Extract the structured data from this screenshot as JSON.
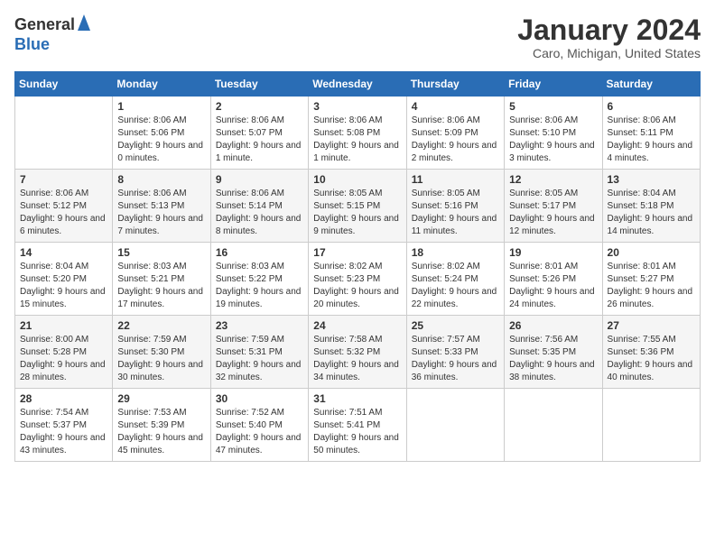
{
  "logo": {
    "general": "General",
    "blue": "Blue"
  },
  "title": {
    "month_year": "January 2024",
    "location": "Caro, Michigan, United States"
  },
  "days_of_week": [
    "Sunday",
    "Monday",
    "Tuesday",
    "Wednesday",
    "Thursday",
    "Friday",
    "Saturday"
  ],
  "weeks": [
    [
      {
        "day": "",
        "sunrise": "",
        "sunset": "",
        "daylight": ""
      },
      {
        "day": "1",
        "sunrise": "Sunrise: 8:06 AM",
        "sunset": "Sunset: 5:06 PM",
        "daylight": "Daylight: 9 hours and 0 minutes."
      },
      {
        "day": "2",
        "sunrise": "Sunrise: 8:06 AM",
        "sunset": "Sunset: 5:07 PM",
        "daylight": "Daylight: 9 hours and 1 minute."
      },
      {
        "day": "3",
        "sunrise": "Sunrise: 8:06 AM",
        "sunset": "Sunset: 5:08 PM",
        "daylight": "Daylight: 9 hours and 1 minute."
      },
      {
        "day": "4",
        "sunrise": "Sunrise: 8:06 AM",
        "sunset": "Sunset: 5:09 PM",
        "daylight": "Daylight: 9 hours and 2 minutes."
      },
      {
        "day": "5",
        "sunrise": "Sunrise: 8:06 AM",
        "sunset": "Sunset: 5:10 PM",
        "daylight": "Daylight: 9 hours and 3 minutes."
      },
      {
        "day": "6",
        "sunrise": "Sunrise: 8:06 AM",
        "sunset": "Sunset: 5:11 PM",
        "daylight": "Daylight: 9 hours and 4 minutes."
      }
    ],
    [
      {
        "day": "7",
        "sunrise": "Sunrise: 8:06 AM",
        "sunset": "Sunset: 5:12 PM",
        "daylight": "Daylight: 9 hours and 6 minutes."
      },
      {
        "day": "8",
        "sunrise": "Sunrise: 8:06 AM",
        "sunset": "Sunset: 5:13 PM",
        "daylight": "Daylight: 9 hours and 7 minutes."
      },
      {
        "day": "9",
        "sunrise": "Sunrise: 8:06 AM",
        "sunset": "Sunset: 5:14 PM",
        "daylight": "Daylight: 9 hours and 8 minutes."
      },
      {
        "day": "10",
        "sunrise": "Sunrise: 8:05 AM",
        "sunset": "Sunset: 5:15 PM",
        "daylight": "Daylight: 9 hours and 9 minutes."
      },
      {
        "day": "11",
        "sunrise": "Sunrise: 8:05 AM",
        "sunset": "Sunset: 5:16 PM",
        "daylight": "Daylight: 9 hours and 11 minutes."
      },
      {
        "day": "12",
        "sunrise": "Sunrise: 8:05 AM",
        "sunset": "Sunset: 5:17 PM",
        "daylight": "Daylight: 9 hours and 12 minutes."
      },
      {
        "day": "13",
        "sunrise": "Sunrise: 8:04 AM",
        "sunset": "Sunset: 5:18 PM",
        "daylight": "Daylight: 9 hours and 14 minutes."
      }
    ],
    [
      {
        "day": "14",
        "sunrise": "Sunrise: 8:04 AM",
        "sunset": "Sunset: 5:20 PM",
        "daylight": "Daylight: 9 hours and 15 minutes."
      },
      {
        "day": "15",
        "sunrise": "Sunrise: 8:03 AM",
        "sunset": "Sunset: 5:21 PM",
        "daylight": "Daylight: 9 hours and 17 minutes."
      },
      {
        "day": "16",
        "sunrise": "Sunrise: 8:03 AM",
        "sunset": "Sunset: 5:22 PM",
        "daylight": "Daylight: 9 hours and 19 minutes."
      },
      {
        "day": "17",
        "sunrise": "Sunrise: 8:02 AM",
        "sunset": "Sunset: 5:23 PM",
        "daylight": "Daylight: 9 hours and 20 minutes."
      },
      {
        "day": "18",
        "sunrise": "Sunrise: 8:02 AM",
        "sunset": "Sunset: 5:24 PM",
        "daylight": "Daylight: 9 hours and 22 minutes."
      },
      {
        "day": "19",
        "sunrise": "Sunrise: 8:01 AM",
        "sunset": "Sunset: 5:26 PM",
        "daylight": "Daylight: 9 hours and 24 minutes."
      },
      {
        "day": "20",
        "sunrise": "Sunrise: 8:01 AM",
        "sunset": "Sunset: 5:27 PM",
        "daylight": "Daylight: 9 hours and 26 minutes."
      }
    ],
    [
      {
        "day": "21",
        "sunrise": "Sunrise: 8:00 AM",
        "sunset": "Sunset: 5:28 PM",
        "daylight": "Daylight: 9 hours and 28 minutes."
      },
      {
        "day": "22",
        "sunrise": "Sunrise: 7:59 AM",
        "sunset": "Sunset: 5:30 PM",
        "daylight": "Daylight: 9 hours and 30 minutes."
      },
      {
        "day": "23",
        "sunrise": "Sunrise: 7:59 AM",
        "sunset": "Sunset: 5:31 PM",
        "daylight": "Daylight: 9 hours and 32 minutes."
      },
      {
        "day": "24",
        "sunrise": "Sunrise: 7:58 AM",
        "sunset": "Sunset: 5:32 PM",
        "daylight": "Daylight: 9 hours and 34 minutes."
      },
      {
        "day": "25",
        "sunrise": "Sunrise: 7:57 AM",
        "sunset": "Sunset: 5:33 PM",
        "daylight": "Daylight: 9 hours and 36 minutes."
      },
      {
        "day": "26",
        "sunrise": "Sunrise: 7:56 AM",
        "sunset": "Sunset: 5:35 PM",
        "daylight": "Daylight: 9 hours and 38 minutes."
      },
      {
        "day": "27",
        "sunrise": "Sunrise: 7:55 AM",
        "sunset": "Sunset: 5:36 PM",
        "daylight": "Daylight: 9 hours and 40 minutes."
      }
    ],
    [
      {
        "day": "28",
        "sunrise": "Sunrise: 7:54 AM",
        "sunset": "Sunset: 5:37 PM",
        "daylight": "Daylight: 9 hours and 43 minutes."
      },
      {
        "day": "29",
        "sunrise": "Sunrise: 7:53 AM",
        "sunset": "Sunset: 5:39 PM",
        "daylight": "Daylight: 9 hours and 45 minutes."
      },
      {
        "day": "30",
        "sunrise": "Sunrise: 7:52 AM",
        "sunset": "Sunset: 5:40 PM",
        "daylight": "Daylight: 9 hours and 47 minutes."
      },
      {
        "day": "31",
        "sunrise": "Sunrise: 7:51 AM",
        "sunset": "Sunset: 5:41 PM",
        "daylight": "Daylight: 9 hours and 50 minutes."
      },
      {
        "day": "",
        "sunrise": "",
        "sunset": "",
        "daylight": ""
      },
      {
        "day": "",
        "sunrise": "",
        "sunset": "",
        "daylight": ""
      },
      {
        "day": "",
        "sunrise": "",
        "sunset": "",
        "daylight": ""
      }
    ]
  ]
}
